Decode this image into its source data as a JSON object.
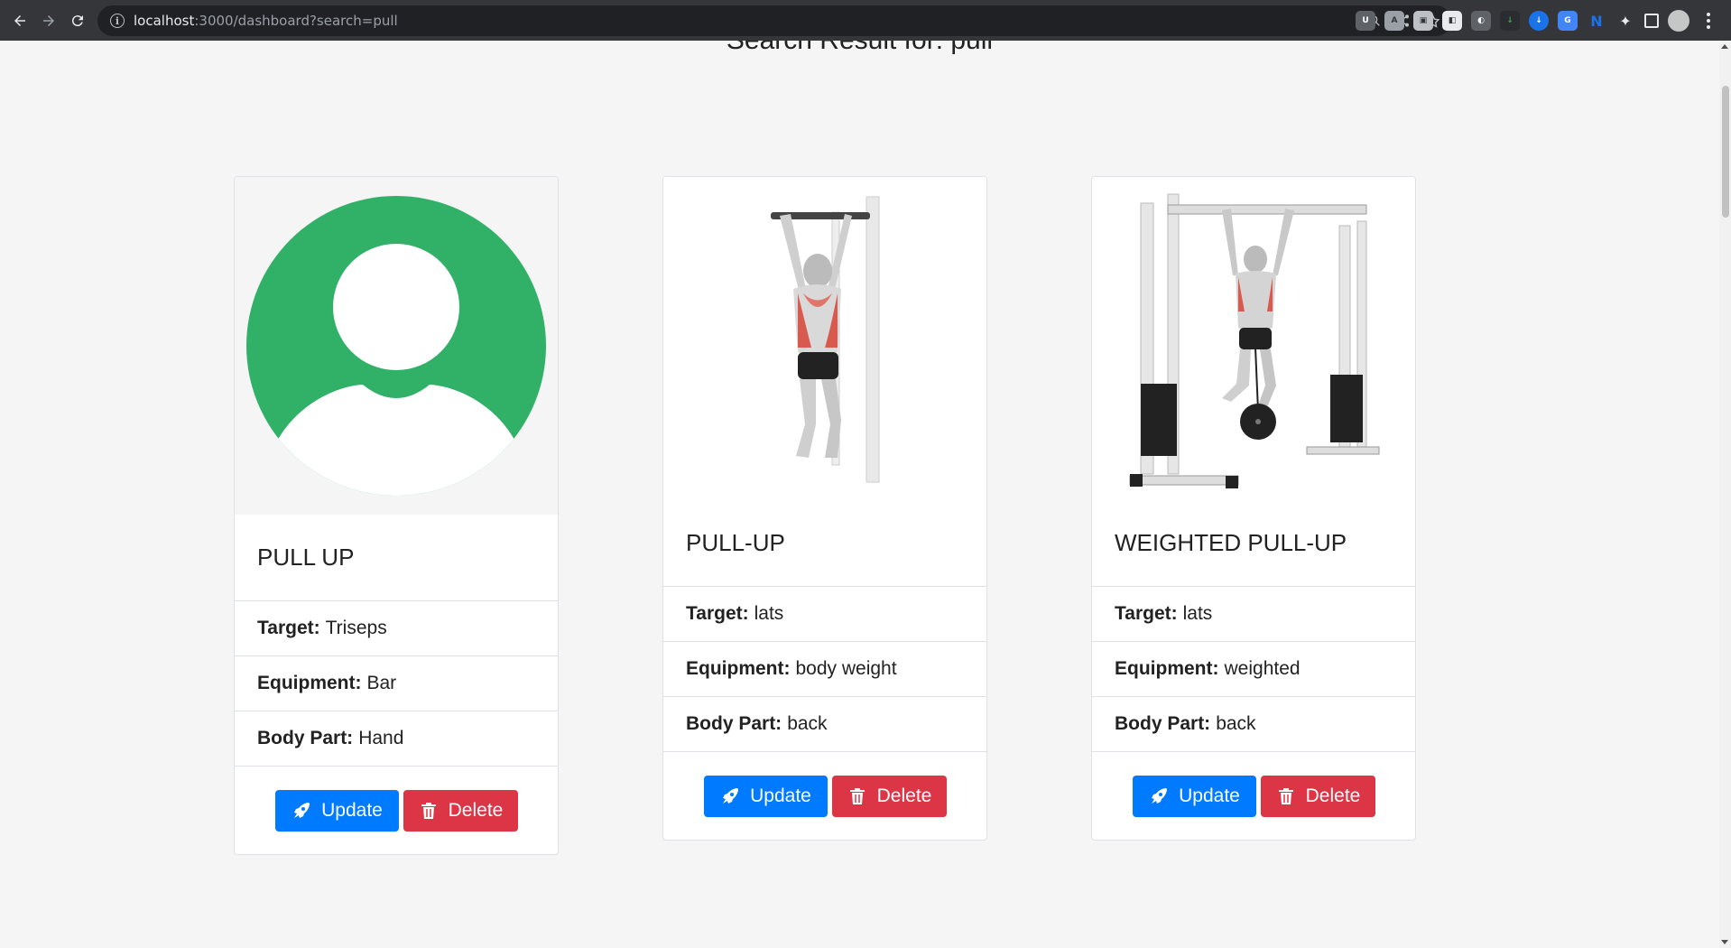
{
  "browser": {
    "url_host": "localhost",
    "url_path": ":3000/dashboard?search=pull"
  },
  "page": {
    "heading": "Search Result for: pull"
  },
  "labels": {
    "target": "Target:",
    "equipment": "Equipment:",
    "body_part": "Body Part:",
    "update": "Update",
    "delete": "Delete"
  },
  "cards": [
    {
      "title": "PULL UP",
      "target": "Triseps",
      "equipment": "Bar",
      "body_part": "Hand",
      "image": "default-avatar"
    },
    {
      "title": "PULL-UP",
      "target": "lats",
      "equipment": "body weight",
      "body_part": "back",
      "image": "pull-up-illustration"
    },
    {
      "title": "WEIGHTED PULL-UP",
      "target": "lats",
      "equipment": "weighted",
      "body_part": "back",
      "image": "weighted-pull-up-illustration"
    }
  ],
  "colors": {
    "update": "#007bff",
    "delete": "#dc3545",
    "avatar": "#31b168"
  }
}
